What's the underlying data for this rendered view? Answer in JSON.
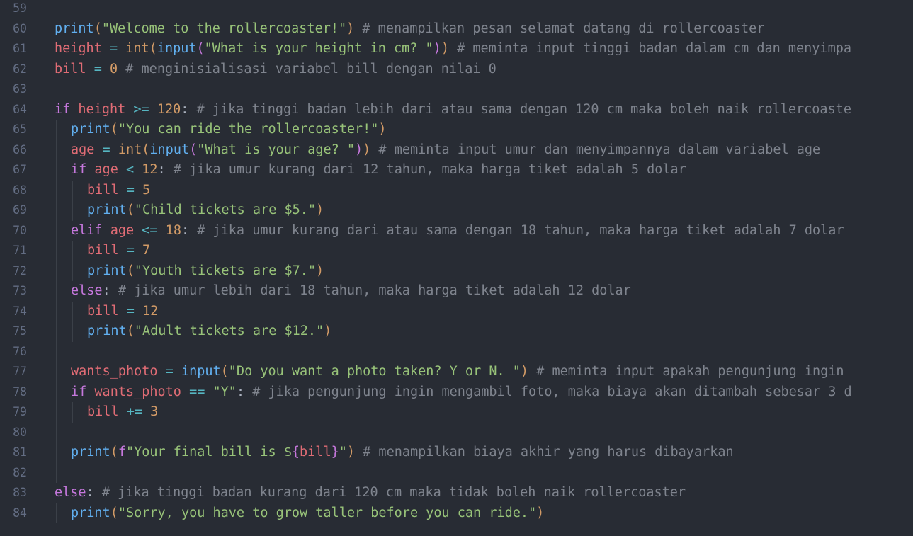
{
  "editor": {
    "theme": {
      "background": "#282c34",
      "line_number": "#636d83",
      "indent_guide": "#3b4048"
    },
    "lines": [
      {
        "n": "59",
        "indent": 0,
        "tokens": []
      },
      {
        "n": "60",
        "indent": 0,
        "tokens": [
          {
            "t": "print",
            "c": "fn"
          },
          {
            "t": "(",
            "c": "brk1"
          },
          {
            "t": "\"Welcome to the rollercoaster!\"",
            "c": "str"
          },
          {
            "t": ")",
            "c": "brk1"
          },
          {
            "t": " # menampilkan pesan selamat datang di rollercoaster",
            "c": "com"
          }
        ]
      },
      {
        "n": "61",
        "indent": 0,
        "tokens": [
          {
            "t": "height",
            "c": "var"
          },
          {
            "t": " = ",
            "c": "op"
          },
          {
            "t": "int",
            "c": "num"
          },
          {
            "t": "(",
            "c": "brk1"
          },
          {
            "t": "input",
            "c": "fn"
          },
          {
            "t": "(",
            "c": "brk2"
          },
          {
            "t": "\"What is your height in cm? \"",
            "c": "str"
          },
          {
            "t": ")",
            "c": "brk2"
          },
          {
            "t": ")",
            "c": "brk1"
          },
          {
            "t": " # meminta input tinggi badan dalam cm dan menyimpa",
            "c": "com"
          }
        ]
      },
      {
        "n": "62",
        "indent": 0,
        "tokens": [
          {
            "t": "bill",
            "c": "var"
          },
          {
            "t": " = ",
            "c": "op"
          },
          {
            "t": "0",
            "c": "num"
          },
          {
            "t": " # menginisialisasi variabel bill dengan nilai 0",
            "c": "com"
          }
        ]
      },
      {
        "n": "63",
        "indent": 0,
        "tokens": []
      },
      {
        "n": "64",
        "indent": 0,
        "tokens": [
          {
            "t": "if",
            "c": "kw"
          },
          {
            "t": " ",
            "c": "plain"
          },
          {
            "t": "height",
            "c": "var"
          },
          {
            "t": " >= ",
            "c": "op"
          },
          {
            "t": "120",
            "c": "num"
          },
          {
            "t": ":",
            "c": "punc"
          },
          {
            "t": " # jika tinggi badan lebih dari atau sama dengan 120 cm maka boleh naik rollercoaste",
            "c": "com"
          }
        ]
      },
      {
        "n": "65",
        "indent": 1,
        "tokens": [
          {
            "t": "print",
            "c": "fn"
          },
          {
            "t": "(",
            "c": "brk1"
          },
          {
            "t": "\"You can ride the rollercoaster!\"",
            "c": "str"
          },
          {
            "t": ")",
            "c": "brk1"
          }
        ]
      },
      {
        "n": "66",
        "indent": 1,
        "tokens": [
          {
            "t": "age",
            "c": "var"
          },
          {
            "t": " = ",
            "c": "op"
          },
          {
            "t": "int",
            "c": "num"
          },
          {
            "t": "(",
            "c": "brk1"
          },
          {
            "t": "input",
            "c": "fn"
          },
          {
            "t": "(",
            "c": "brk2"
          },
          {
            "t": "\"What is your age? \"",
            "c": "str"
          },
          {
            "t": ")",
            "c": "brk2"
          },
          {
            "t": ")",
            "c": "brk1"
          },
          {
            "t": " # meminta input umur dan menyimpannya dalam variabel age",
            "c": "com"
          }
        ]
      },
      {
        "n": "67",
        "indent": 1,
        "tokens": [
          {
            "t": "if",
            "c": "kw"
          },
          {
            "t": " ",
            "c": "plain"
          },
          {
            "t": "age",
            "c": "var"
          },
          {
            "t": " < ",
            "c": "op"
          },
          {
            "t": "12",
            "c": "num"
          },
          {
            "t": ":",
            "c": "punc"
          },
          {
            "t": " # jika umur kurang dari 12 tahun, maka harga tiket adalah 5 dolar",
            "c": "com"
          }
        ]
      },
      {
        "n": "68",
        "indent": 2,
        "tokens": [
          {
            "t": "bill",
            "c": "var"
          },
          {
            "t": " = ",
            "c": "op"
          },
          {
            "t": "5",
            "c": "num"
          }
        ]
      },
      {
        "n": "69",
        "indent": 2,
        "tokens": [
          {
            "t": "print",
            "c": "fn"
          },
          {
            "t": "(",
            "c": "brk1"
          },
          {
            "t": "\"Child tickets are $5.\"",
            "c": "str"
          },
          {
            "t": ")",
            "c": "brk1"
          }
        ]
      },
      {
        "n": "70",
        "indent": 1,
        "tokens": [
          {
            "t": "elif",
            "c": "kw"
          },
          {
            "t": " ",
            "c": "plain"
          },
          {
            "t": "age",
            "c": "var"
          },
          {
            "t": " <= ",
            "c": "op"
          },
          {
            "t": "18",
            "c": "num"
          },
          {
            "t": ":",
            "c": "punc"
          },
          {
            "t": " # jika umur kurang dari atau sama dengan 18 tahun, maka harga tiket adalah 7 dolar",
            "c": "com"
          }
        ]
      },
      {
        "n": "71",
        "indent": 2,
        "tokens": [
          {
            "t": "bill",
            "c": "var"
          },
          {
            "t": " = ",
            "c": "op"
          },
          {
            "t": "7",
            "c": "num"
          }
        ]
      },
      {
        "n": "72",
        "indent": 2,
        "tokens": [
          {
            "t": "print",
            "c": "fn"
          },
          {
            "t": "(",
            "c": "brk1"
          },
          {
            "t": "\"Youth tickets are $7.\"",
            "c": "str"
          },
          {
            "t": ")",
            "c": "brk1"
          }
        ]
      },
      {
        "n": "73",
        "indent": 1,
        "tokens": [
          {
            "t": "else",
            "c": "kw"
          },
          {
            "t": ":",
            "c": "punc"
          },
          {
            "t": " # jika umur lebih dari 18 tahun, maka harga tiket adalah 12 dolar",
            "c": "com"
          }
        ]
      },
      {
        "n": "74",
        "indent": 2,
        "tokens": [
          {
            "t": "bill",
            "c": "var"
          },
          {
            "t": " = ",
            "c": "op"
          },
          {
            "t": "12",
            "c": "num"
          }
        ]
      },
      {
        "n": "75",
        "indent": 2,
        "tokens": [
          {
            "t": "print",
            "c": "fn"
          },
          {
            "t": "(",
            "c": "brk1"
          },
          {
            "t": "\"Adult tickets are $12.\"",
            "c": "str"
          },
          {
            "t": ")",
            "c": "brk1"
          }
        ]
      },
      {
        "n": "76",
        "indent": 1,
        "tokens": []
      },
      {
        "n": "77",
        "indent": 1,
        "tokens": [
          {
            "t": "wants_photo",
            "c": "var"
          },
          {
            "t": " = ",
            "c": "op"
          },
          {
            "t": "input",
            "c": "fn"
          },
          {
            "t": "(",
            "c": "brk1"
          },
          {
            "t": "\"Do you want a photo taken? Y or N. \"",
            "c": "str"
          },
          {
            "t": ")",
            "c": "brk1"
          },
          {
            "t": " # meminta input apakah pengunjung ingin",
            "c": "com"
          }
        ]
      },
      {
        "n": "78",
        "indent": 1,
        "tokens": [
          {
            "t": "if",
            "c": "kw"
          },
          {
            "t": " ",
            "c": "plain"
          },
          {
            "t": "wants_photo",
            "c": "var"
          },
          {
            "t": " == ",
            "c": "op"
          },
          {
            "t": "\"Y\"",
            "c": "str"
          },
          {
            "t": ":",
            "c": "punc"
          },
          {
            "t": " # jika pengunjung ingin mengambil foto, maka biaya akan ditambah sebesar 3 d",
            "c": "com"
          }
        ]
      },
      {
        "n": "79",
        "indent": 2,
        "tokens": [
          {
            "t": "bill",
            "c": "var"
          },
          {
            "t": " += ",
            "c": "op"
          },
          {
            "t": "3",
            "c": "num"
          }
        ]
      },
      {
        "n": "80",
        "indent": 1,
        "tokens": []
      },
      {
        "n": "81",
        "indent": 1,
        "tokens": [
          {
            "t": "print",
            "c": "fn"
          },
          {
            "t": "(",
            "c": "brk1"
          },
          {
            "t": "f",
            "c": "kw"
          },
          {
            "t": "\"Your final bill is $",
            "c": "str"
          },
          {
            "t": "{",
            "c": "brk2"
          },
          {
            "t": "bill",
            "c": "var"
          },
          {
            "t": "}",
            "c": "brk2"
          },
          {
            "t": "\"",
            "c": "str"
          },
          {
            "t": ")",
            "c": "brk1"
          },
          {
            "t": " # menampilkan biaya akhir yang harus dibayarkan",
            "c": "com"
          }
        ]
      },
      {
        "n": "82",
        "indent": 1,
        "tokens": []
      },
      {
        "n": "83",
        "indent": 0,
        "tokens": [
          {
            "t": "else",
            "c": "kw"
          },
          {
            "t": ":",
            "c": "punc"
          },
          {
            "t": " # jika tinggi badan kurang dari 120 cm maka tidak boleh naik rollercoaster",
            "c": "com"
          }
        ]
      },
      {
        "n": "84",
        "indent": 1,
        "tokens": [
          {
            "t": "print",
            "c": "fn"
          },
          {
            "t": "(",
            "c": "brk1"
          },
          {
            "t": "\"Sorry, you have to grow taller before you can ride.\"",
            "c": "str"
          },
          {
            "t": ")",
            "c": "brk1"
          }
        ]
      }
    ]
  }
}
